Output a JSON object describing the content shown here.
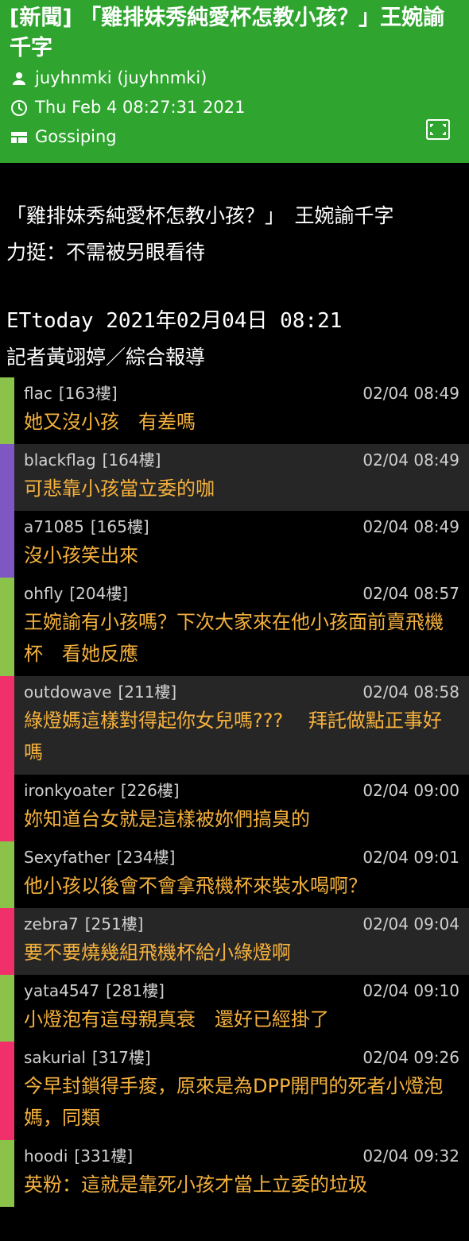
{
  "header": {
    "title": "[新聞] 「雞排妹秀純愛杯怎教小孩？」王婉諭千字",
    "author": "juyhnmki (juyhnmki)",
    "date": "Thu Feb  4 08:27:31 2021",
    "board": "Gossiping",
    "colors": {
      "background": "#2fa52f"
    }
  },
  "article": {
    "line1": "「雞排妹秀純愛杯怎教小孩？」　王婉諭千字",
    "line2": "力挺：不需被另眼看待",
    "source": "ETtoday 2021年02月04日 08:21",
    "reporter": "記者黃翊婷／綜合報導"
  },
  "comments": [
    {
      "user": "flac",
      "floor": "[163樓]",
      "time": "02/04 08:49",
      "text": "她又沒小孩　有差嗎",
      "color": "#8bc34a",
      "alt": false
    },
    {
      "user": "blackflag",
      "floor": "[164樓]",
      "time": "02/04 08:49",
      "text": "可悲靠小孩當立委的咖",
      "color": "#7e57c2",
      "alt": true
    },
    {
      "user": "a71085",
      "floor": "[165樓]",
      "time": "02/04 08:49",
      "text": "沒小孩笑出來",
      "color": "#7e57c2",
      "alt": false
    },
    {
      "user": "ohfly",
      "floor": "[204樓]",
      "time": "02/04 08:57",
      "text": "王婉諭有小孩嗎？下次大家來在他小孩面前賣飛機杯　看她反應",
      "color": "#8bc34a",
      "alt": false
    },
    {
      "user": "outdowave",
      "floor": "[211樓]",
      "time": "02/04 08:58",
      "text": "綠燈媽這樣對得起你女兒嗎???　 拜託做點正事好嗎",
      "color": "#f0306a",
      "alt": true
    },
    {
      "user": "ironkyoater",
      "floor": "[226樓]",
      "time": "02/04 09:00",
      "text": "妳知道台女就是這樣被妳們搞臭的",
      "color": "#f0306a",
      "alt": false
    },
    {
      "user": "Sexyfather",
      "floor": "[234樓]",
      "time": "02/04 09:01",
      "text": "他小孩以後會不會拿飛機杯來裝水喝啊？",
      "color": "#8bc34a",
      "alt": false
    },
    {
      "user": "zebra7",
      "floor": "[251樓]",
      "time": "02/04 09:04",
      "text": "要不要燒幾組飛機杯給小綠燈啊",
      "color": "#f0306a",
      "alt": true
    },
    {
      "user": "yata4547",
      "floor": "[281樓]",
      "time": "02/04 09:10",
      "text": "小燈泡有這母親真衰　還好已經掛了",
      "color": "#8bc34a",
      "alt": false
    },
    {
      "user": "sakurial",
      "floor": "[317樓]",
      "time": "02/04 09:26",
      "text": "今早封鎖得手痠，原來是為DPP開門的死者小燈泡媽，同類",
      "color": "#f0306a",
      "alt": false
    },
    {
      "user": "hoodi",
      "floor": "[331樓]",
      "time": "02/04 09:32",
      "text": "英粉：這就是靠死小孩才當上立委的垃圾",
      "color": "#8bc34a",
      "alt": false
    }
  ]
}
